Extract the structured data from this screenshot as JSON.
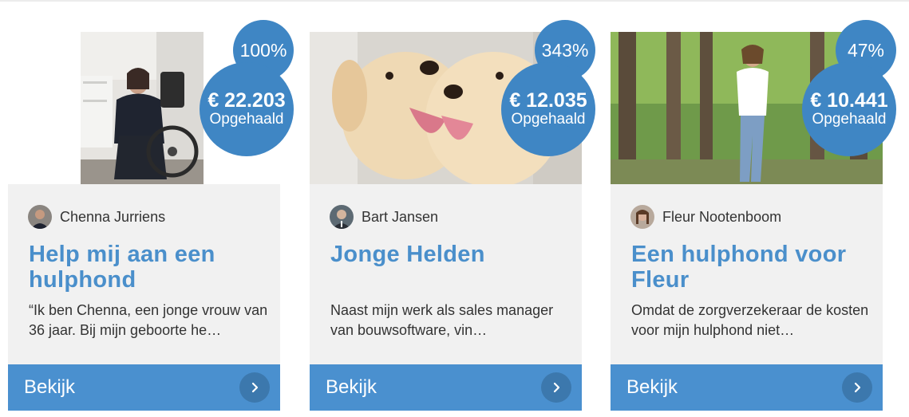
{
  "campaigns": [
    {
      "percent": "100%",
      "amount": "€ 22.203",
      "raised_label": "Opgehaald",
      "owner": "Chenna Jurriens",
      "title": "Help mij aan een hulphond",
      "description": "“Ik ben Chenna, een jonge vrouw van 36 jaar. Bij mijn geboorte he…",
      "button": "Bekijk",
      "image": "woman-in-wheelchair-photo"
    },
    {
      "percent": "343%",
      "amount": "€ 12.035",
      "raised_label": "Opgehaald",
      "owner": "Bart Jansen",
      "title": "Jonge Helden",
      "description": "Naast mijn werk als sales manager van bouwsoftware, vin…",
      "button": "Bekijk",
      "image": "labrador-puppies-photo"
    },
    {
      "percent": "47%",
      "amount": "€ 10.441",
      "raised_label": "Opgehaald",
      "owner": "Fleur Nootenboom",
      "title": "Een hulphond voor Fleur",
      "description": "Omdat de zorgverzekeraar de kosten voor mijn hulphond niet…",
      "button": "Bekijk",
      "image": "woman-in-forest-photo"
    }
  ],
  "colors": {
    "accent": "#4a90cf",
    "badge": "#3f86c4",
    "title": "#4a8fcb",
    "card_background": "#f1f1f1"
  }
}
